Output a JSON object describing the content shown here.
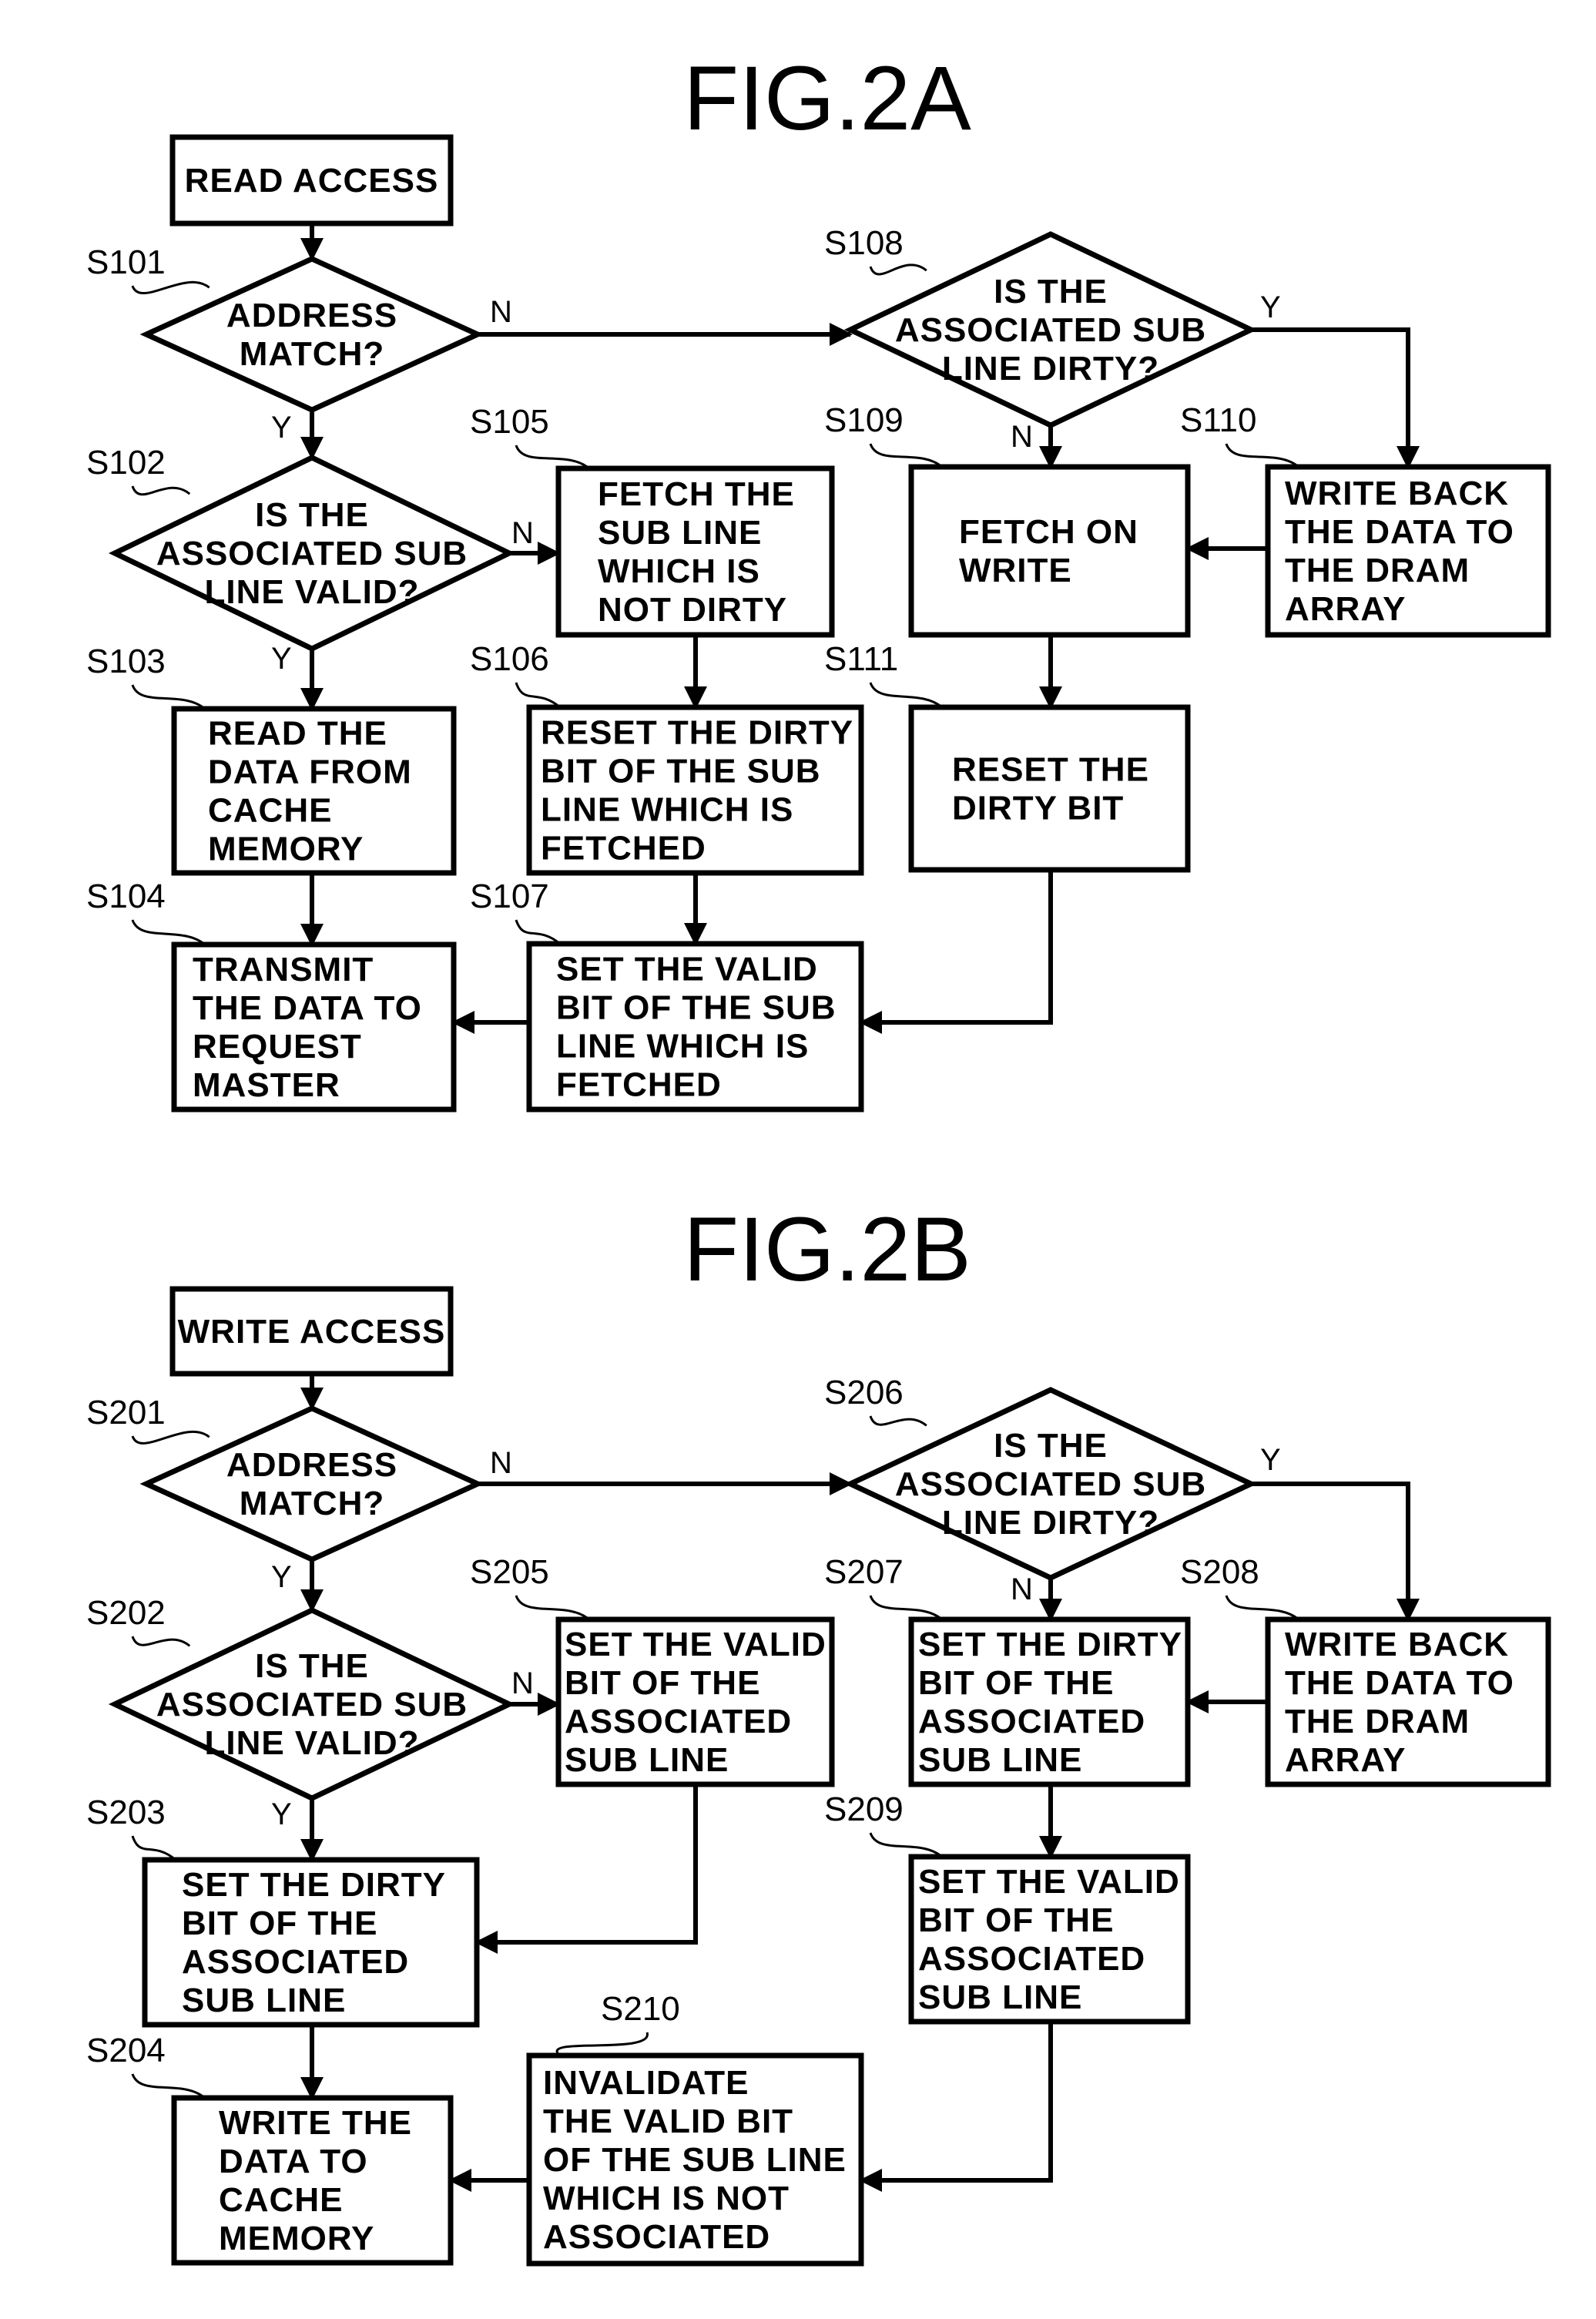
{
  "figures": [
    {
      "title": "FIG.2A",
      "start": {
        "label": "READ ACCESS"
      },
      "steps": [
        {
          "id": "S101",
          "type": "decision",
          "lines": [
            "ADDRESS",
            "MATCH?"
          ],
          "yes": "Y",
          "no": "N"
        },
        {
          "id": "S102",
          "type": "decision",
          "lines": [
            "IS THE",
            "ASSOCIATED SUB",
            "LINE VALID?"
          ],
          "yes": "Y",
          "no": "N"
        },
        {
          "id": "S103",
          "type": "process",
          "lines": [
            "READ THE",
            "DATA FROM",
            "CACHE",
            "MEMORY"
          ]
        },
        {
          "id": "S104",
          "type": "process",
          "lines": [
            "TRANSMIT",
            "THE DATA TO",
            "REQUEST",
            "MASTER"
          ]
        },
        {
          "id": "S105",
          "type": "process",
          "lines": [
            "FETCH THE",
            "SUB LINE",
            "WHICH IS",
            "NOT DIRTY"
          ]
        },
        {
          "id": "S106",
          "type": "process",
          "lines": [
            "RESET THE DIRTY",
            "BIT OF THE SUB",
            "LINE WHICH IS",
            "FETCHED"
          ]
        },
        {
          "id": "S107",
          "type": "process",
          "lines": [
            "SET THE VALID",
            "BIT OF THE SUB",
            "LINE WHICH IS",
            "FETCHED"
          ]
        },
        {
          "id": "S108",
          "type": "decision",
          "lines": [
            "IS THE",
            "ASSOCIATED SUB",
            "LINE DIRTY?"
          ],
          "yes": "Y",
          "no": "N"
        },
        {
          "id": "S109",
          "type": "process",
          "lines": [
            "FETCH ON",
            "WRITE"
          ]
        },
        {
          "id": "S110",
          "type": "process",
          "lines": [
            "WRITE BACK",
            "THE DATA TO",
            "THE DRAM",
            "ARRAY"
          ]
        },
        {
          "id": "S111",
          "type": "process",
          "lines": [
            "RESET THE",
            "DIRTY BIT"
          ]
        }
      ]
    },
    {
      "title": "FIG.2B",
      "start": {
        "label": "WRITE ACCESS"
      },
      "steps": [
        {
          "id": "S201",
          "type": "decision",
          "lines": [
            "ADDRESS",
            "MATCH?"
          ],
          "yes": "Y",
          "no": "N"
        },
        {
          "id": "S202",
          "type": "decision",
          "lines": [
            "IS THE",
            "ASSOCIATED SUB",
            "LINE VALID?"
          ],
          "yes": "Y",
          "no": "N"
        },
        {
          "id": "S203",
          "type": "process",
          "lines": [
            "SET THE DIRTY",
            "BIT OF THE",
            "ASSOCIATED",
            "SUB LINE"
          ]
        },
        {
          "id": "S204",
          "type": "process",
          "lines": [
            "WRITE THE",
            "DATA TO",
            "CACHE",
            "MEMORY"
          ]
        },
        {
          "id": "S205",
          "type": "process",
          "lines": [
            "SET THE VALID",
            "BIT OF THE",
            "ASSOCIATED",
            "SUB LINE"
          ]
        },
        {
          "id": "S206",
          "type": "decision",
          "lines": [
            "IS THE",
            "ASSOCIATED SUB",
            "LINE DIRTY?"
          ],
          "yes": "Y",
          "no": "N"
        },
        {
          "id": "S207",
          "type": "process",
          "lines": [
            "SET THE DIRTY",
            "BIT OF THE",
            "ASSOCIATED",
            "SUB LINE"
          ]
        },
        {
          "id": "S208",
          "type": "process",
          "lines": [
            "WRITE BACK",
            "THE DATA TO",
            "THE DRAM",
            "ARRAY"
          ]
        },
        {
          "id": "S209",
          "type": "process",
          "lines": [
            "SET THE VALID",
            "BIT OF THE",
            "ASSOCIATED",
            "SUB LINE"
          ]
        },
        {
          "id": "S210",
          "type": "process",
          "lines": [
            "INVALIDATE",
            "THE VALID BIT",
            "OF THE SUB LINE",
            "WHICH IS NOT",
            "ASSOCIATED"
          ]
        }
      ]
    }
  ],
  "edges": [
    {
      "figure": 0,
      "from": "START",
      "to": "S101",
      "label": ""
    },
    {
      "figure": 0,
      "from": "S101",
      "to": "S102",
      "label": "Y"
    },
    {
      "figure": 0,
      "from": "S101",
      "to": "S108",
      "label": "N"
    },
    {
      "figure": 0,
      "from": "S102",
      "to": "S103",
      "label": "Y"
    },
    {
      "figure": 0,
      "from": "S102",
      "to": "S105",
      "label": "N"
    },
    {
      "figure": 0,
      "from": "S103",
      "to": "S104",
      "label": ""
    },
    {
      "figure": 0,
      "from": "S105",
      "to": "S106",
      "label": ""
    },
    {
      "figure": 0,
      "from": "S106",
      "to": "S107",
      "label": ""
    },
    {
      "figure": 0,
      "from": "S107",
      "to": "S104",
      "label": ""
    },
    {
      "figure": 0,
      "from": "S108",
      "to": "S109",
      "label": "N"
    },
    {
      "figure": 0,
      "from": "S108",
      "to": "S110",
      "label": "Y"
    },
    {
      "figure": 0,
      "from": "S110",
      "to": "S109",
      "label": ""
    },
    {
      "figure": 0,
      "from": "S109",
      "to": "S111",
      "label": ""
    },
    {
      "figure": 0,
      "from": "S111",
      "to": "S107",
      "label": ""
    },
    {
      "figure": 1,
      "from": "START",
      "to": "S201",
      "label": ""
    },
    {
      "figure": 1,
      "from": "S201",
      "to": "S202",
      "label": "Y"
    },
    {
      "figure": 1,
      "from": "S201",
      "to": "S206",
      "label": "N"
    },
    {
      "figure": 1,
      "from": "S202",
      "to": "S203",
      "label": "Y"
    },
    {
      "figure": 1,
      "from": "S202",
      "to": "S205",
      "label": "N"
    },
    {
      "figure": 1,
      "from": "S205",
      "to": "S203",
      "label": ""
    },
    {
      "figure": 1,
      "from": "S203",
      "to": "S204",
      "label": ""
    },
    {
      "figure": 1,
      "from": "S206",
      "to": "S207",
      "label": "N"
    },
    {
      "figure": 1,
      "from": "S206",
      "to": "S208",
      "label": "Y"
    },
    {
      "figure": 1,
      "from": "S208",
      "to": "S207",
      "label": ""
    },
    {
      "figure": 1,
      "from": "S207",
      "to": "S209",
      "label": ""
    },
    {
      "figure": 1,
      "from": "S209",
      "to": "S210",
      "label": ""
    },
    {
      "figure": 1,
      "from": "S210",
      "to": "S204",
      "label": ""
    }
  ]
}
